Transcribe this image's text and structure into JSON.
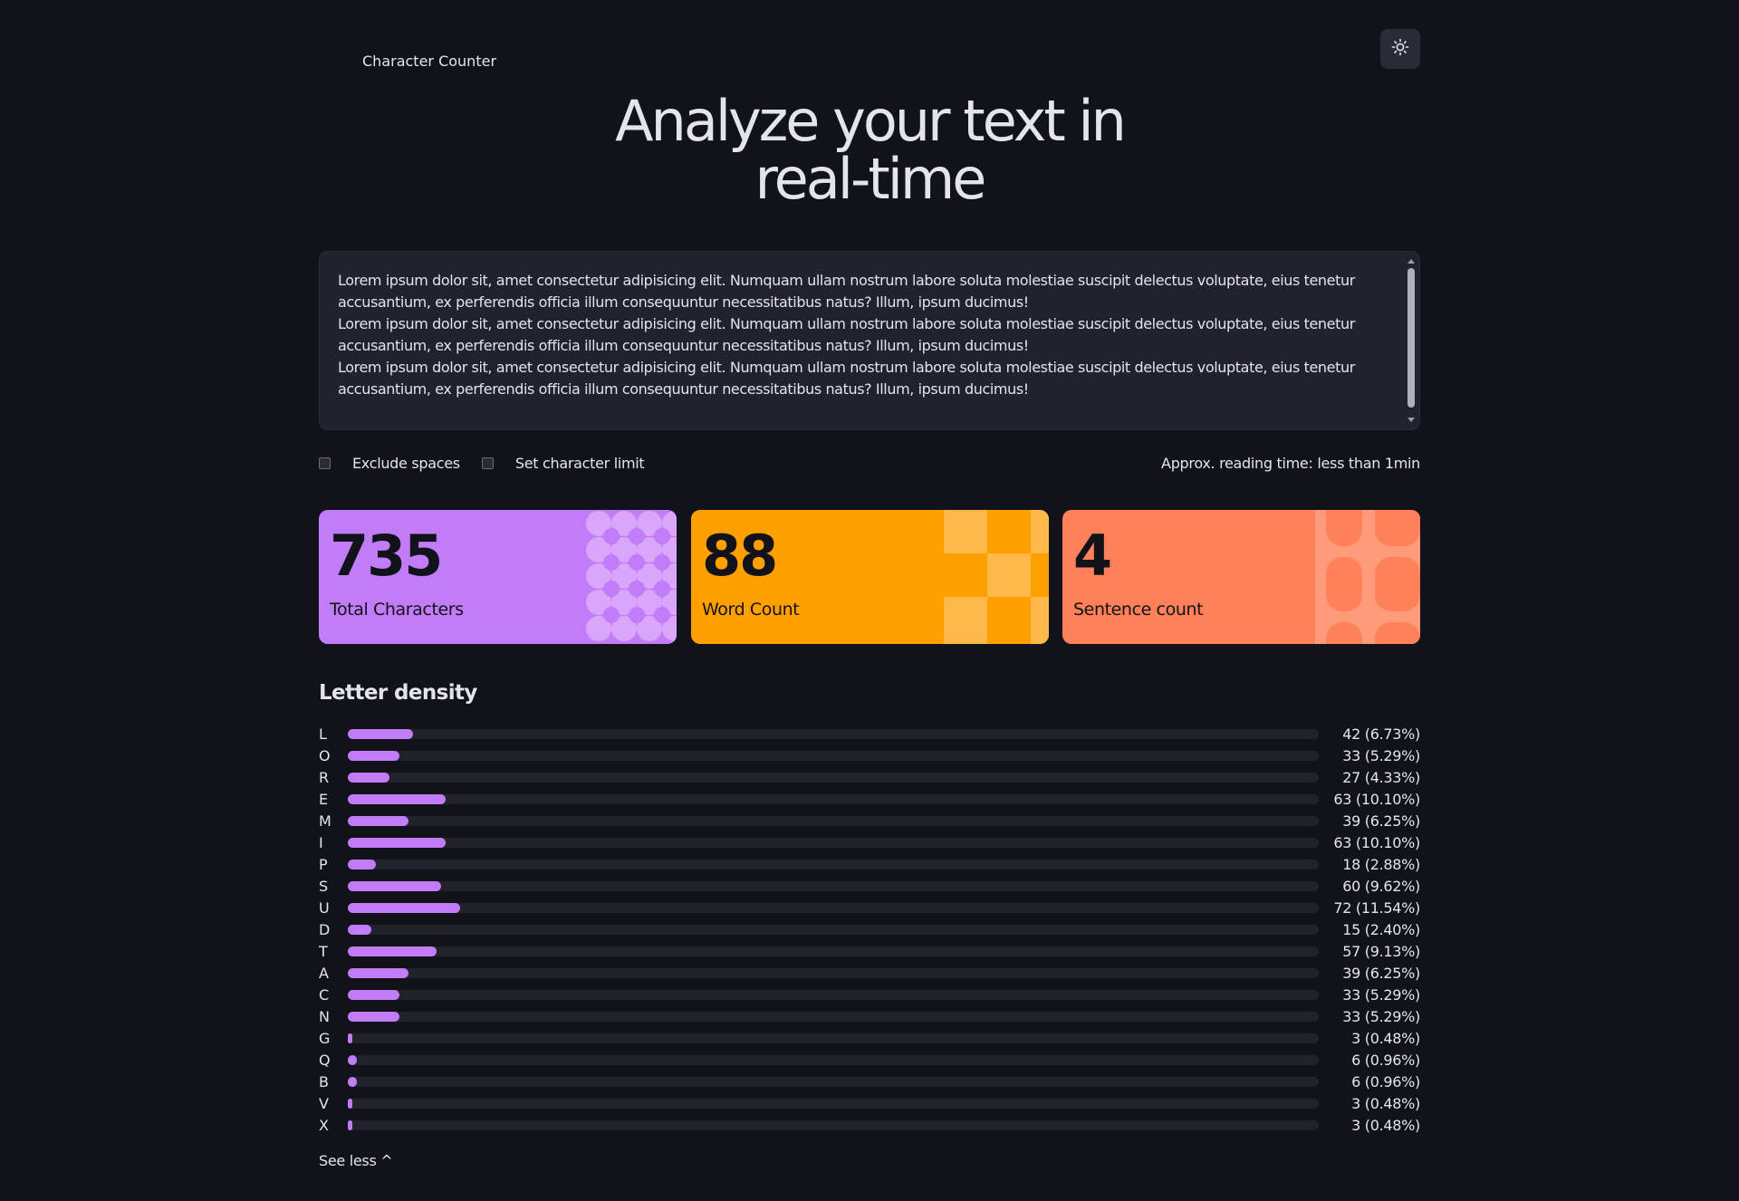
{
  "header": {
    "brand": "Character Counter",
    "theme_toggle_icon": "sun-icon"
  },
  "hero": {
    "line1": "Analyze your text in",
    "line2": "real-time"
  },
  "text_input": {
    "value": "Lorem ipsum dolor sit, amet consectetur adipisicing elit. Numquam ullam nostrum labore soluta molestiae suscipit delectus voluptate, eius tenetur accusantium, ex perferendis officia illum consequuntur necessitatibus natus? Illum, ipsum ducimus!\nLorem ipsum dolor sit, amet consectetur adipisicing elit. Numquam ullam nostrum labore soluta molestiae suscipit delectus voluptate, eius tenetur accusantium, ex perferendis officia illum consequuntur necessitatibus natus? Illum, ipsum ducimus!\nLorem ipsum dolor sit, amet consectetur adipisicing elit. Numquam ullam nostrum labore soluta molestiae suscipit delectus voluptate, eius tenetur accusantium, ex perferendis officia illum consequuntur necessitatibus natus? Illum, ipsum ducimus!"
  },
  "options": {
    "exclude_spaces_label": "Exclude spaces",
    "exclude_spaces_checked": false,
    "char_limit_label": "Set character limit",
    "char_limit_checked": false,
    "reading_time": "Approx. reading time: less than 1min"
  },
  "stats": {
    "total_characters": {
      "value": "735",
      "label": "Total Characters",
      "color": "#c27cf8"
    },
    "word_count": {
      "value": "88",
      "label": "Word Count",
      "color": "#ff9f00"
    },
    "sentence_count": {
      "value": "4",
      "label": "Sentence count",
      "color": "#fe8159"
    }
  },
  "density": {
    "title": "Letter density",
    "bar_color": "#c27cf8",
    "rows": [
      {
        "letter": "L",
        "count": "42 (6.73%)",
        "percent": 6.73
      },
      {
        "letter": "O",
        "count": "33 (5.29%)",
        "percent": 5.29
      },
      {
        "letter": "R",
        "count": "27 (4.33%)",
        "percent": 4.33
      },
      {
        "letter": "E",
        "count": "63 (10.10%)",
        "percent": 10.1
      },
      {
        "letter": "M",
        "count": "39 (6.25%)",
        "percent": 6.25
      },
      {
        "letter": "I",
        "count": "63 (10.10%)",
        "percent": 10.1
      },
      {
        "letter": "P",
        "count": "18 (2.88%)",
        "percent": 2.88
      },
      {
        "letter": "S",
        "count": "60 (9.62%)",
        "percent": 9.62
      },
      {
        "letter": "U",
        "count": "72 (11.54%)",
        "percent": 11.54
      },
      {
        "letter": "D",
        "count": "15 (2.40%)",
        "percent": 2.4
      },
      {
        "letter": "T",
        "count": "57 (9.13%)",
        "percent": 9.13
      },
      {
        "letter": "A",
        "count": "39 (6.25%)",
        "percent": 6.25
      },
      {
        "letter": "C",
        "count": "33 (5.29%)",
        "percent": 5.29
      },
      {
        "letter": "N",
        "count": "33 (5.29%)",
        "percent": 5.29
      },
      {
        "letter": "G",
        "count": "3 (0.48%)",
        "percent": 0.48
      },
      {
        "letter": "Q",
        "count": "6 (0.96%)",
        "percent": 0.96
      },
      {
        "letter": "B",
        "count": "6 (0.96%)",
        "percent": 0.96
      },
      {
        "letter": "V",
        "count": "3 (0.48%)",
        "percent": 0.48
      },
      {
        "letter": "X",
        "count": "3 (0.48%)",
        "percent": 0.48
      }
    ],
    "see_less_label": "See less ^"
  }
}
